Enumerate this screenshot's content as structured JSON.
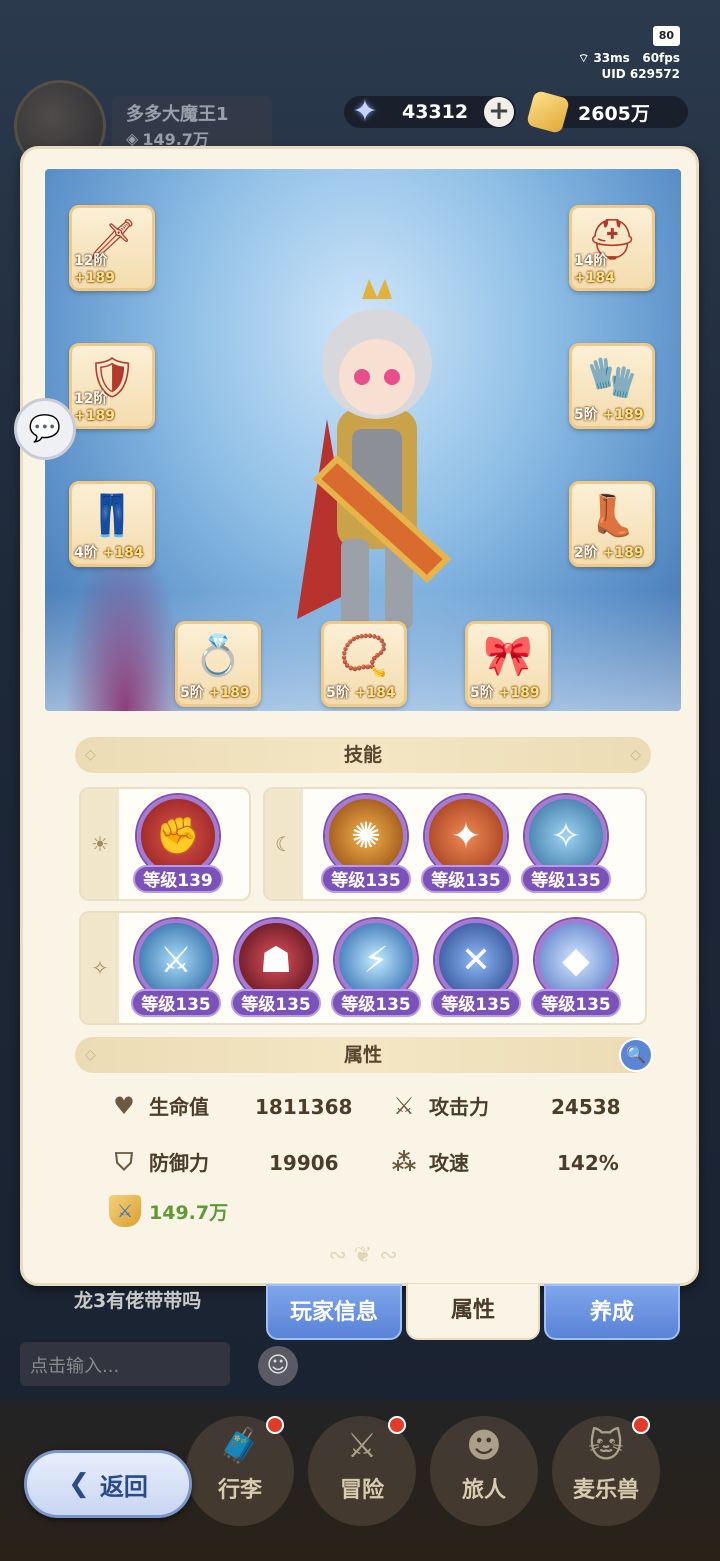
{
  "status": {
    "battery": "80",
    "ping": "33ms",
    "fps": "60fps",
    "uid_label": "UID",
    "uid": "629572"
  },
  "player": {
    "name": "多多大魔王1",
    "power": "149.7万"
  },
  "currency": {
    "stars": "43312",
    "gold": "2605万"
  },
  "equipment": [
    {
      "slot": "weapon",
      "tier": "12阶",
      "bonus": "+189",
      "glyph": "🗡"
    },
    {
      "slot": "armor",
      "tier": "12阶",
      "bonus": "+189",
      "glyph": "🛡"
    },
    {
      "slot": "pants",
      "tier": "4阶",
      "bonus": "+184",
      "glyph": "👖"
    },
    {
      "slot": "helmet",
      "tier": "14阶",
      "bonus": "+184",
      "glyph": "⛑"
    },
    {
      "slot": "gloves",
      "tier": "5阶",
      "bonus": "+189",
      "glyph": "🧤"
    },
    {
      "slot": "boots",
      "tier": "2阶",
      "bonus": "+189",
      "glyph": "👢"
    },
    {
      "slot": "ring",
      "tier": "5阶",
      "bonus": "+189",
      "glyph": "💍"
    },
    {
      "slot": "necklace",
      "tier": "5阶",
      "bonus": "+184",
      "glyph": "📿"
    },
    {
      "slot": "charm",
      "tier": "5阶",
      "bonus": "+189",
      "glyph": "🎀"
    }
  ],
  "skills_header": "技能",
  "skills": {
    "sun": [
      {
        "level": "等级139",
        "color": "#b8322e"
      }
    ],
    "moon": [
      {
        "level": "等级135",
        "color": "#c77a1e"
      },
      {
        "level": "等级135",
        "color": "#d2552f"
      },
      {
        "level": "等级135",
        "color": "#3f8fc4"
      }
    ],
    "star": [
      {
        "level": "等级135",
        "color": "#3a8cd0"
      },
      {
        "level": "等级135",
        "color": "#8a2430"
      },
      {
        "level": "等级135",
        "color": "#3275bf"
      },
      {
        "level": "等级135",
        "color": "#4568b8"
      },
      {
        "level": "等级135",
        "color": "#6c8fd6"
      }
    ]
  },
  "attributes_header": "属性",
  "attributes": {
    "hp_label": "生命值",
    "hp": "1811368",
    "atk_label": "攻击力",
    "atk": "24538",
    "def_label": "防御力",
    "def": "19906",
    "spd_label": "攻速",
    "spd": "142%",
    "power": "149.7万"
  },
  "tabs": {
    "player_info": "玩家信息",
    "attributes": "属性",
    "develop": "养成"
  },
  "chat": {
    "last_message": "龙3有佬带带吗",
    "input_placeholder": "点击输入..."
  },
  "nav": {
    "back": "返回",
    "bag": "行李",
    "adventure": "冒险",
    "traveler": "旅人",
    "pet": "麦乐兽"
  }
}
